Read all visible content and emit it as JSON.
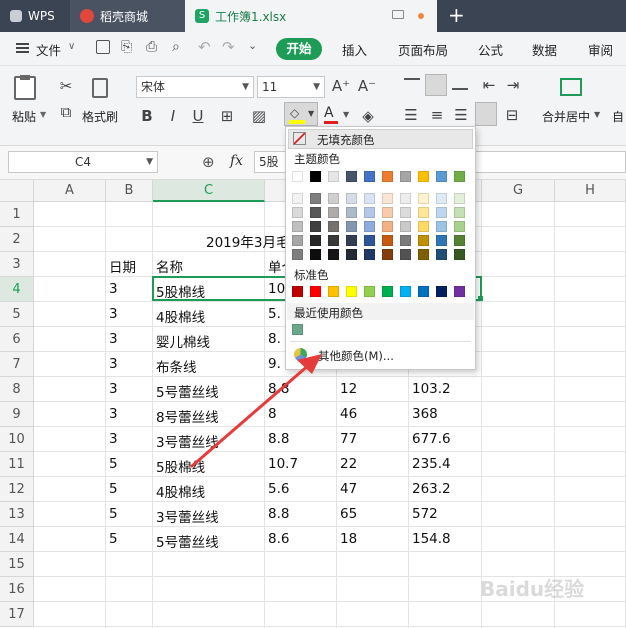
{
  "tabs": {
    "wps": "WPS",
    "shop": "稻壳商城",
    "workbook": "工作簿1.xlsx"
  },
  "menu": {
    "file": "文件",
    "start": "开始",
    "insert": "插入",
    "layout": "页面布局",
    "formula": "公式",
    "data": "数据",
    "review": "审阅"
  },
  "ribbon": {
    "paste": "粘贴",
    "format_painter": "格式刷",
    "font": "宋体",
    "size": "11",
    "merge": "合并居中",
    "auto": "自"
  },
  "formula": {
    "cellref": "C4",
    "fx": "fx",
    "content": "5股"
  },
  "columns": [
    "A",
    "B",
    "C",
    "D",
    "E",
    "F",
    "G",
    "H"
  ],
  "rows": [
    "1",
    "2",
    "3",
    "4",
    "5",
    "6",
    "7",
    "8",
    "9",
    "10",
    "11",
    "12",
    "13",
    "14",
    "15",
    "16",
    "17"
  ],
  "sheet": {
    "title": "2019年3月毛",
    "header": {
      "date": "日期",
      "name": "名称",
      "price": "单个"
    },
    "data": [
      {
        "r": 4,
        "b": "3",
        "c": "5股棉线",
        "d": "10.",
        "e": "",
        "f": ""
      },
      {
        "r": 5,
        "b": "3",
        "c": "4股棉线",
        "d": "5.",
        "e": "",
        "f": ""
      },
      {
        "r": 6,
        "b": "3",
        "c": "婴儿棉线",
        "d": "8.",
        "e": "",
        "f": ""
      },
      {
        "r": 7,
        "b": "3",
        "c": "布条线",
        "d": "9.",
        "e": "",
        "f": ""
      },
      {
        "r": 8,
        "b": "3",
        "c": "5号蕾丝线",
        "d": "8.8",
        "e": "12",
        "f": "103.2"
      },
      {
        "r": 9,
        "b": "3",
        "c": "8号蕾丝线",
        "d": "8",
        "e": "46",
        "f": "368"
      },
      {
        "r": 10,
        "b": "3",
        "c": "3号蕾丝线",
        "d": "8.8",
        "e": "77",
        "f": "677.6"
      },
      {
        "r": 11,
        "b": "5",
        "c": "5股棉线",
        "d": "10.7",
        "e": "22",
        "f": "235.4"
      },
      {
        "r": 12,
        "b": "5",
        "c": "4股棉线",
        "d": "5.6",
        "e": "47",
        "f": "263.2"
      },
      {
        "r": 13,
        "b": "5",
        "c": "3号蕾丝线",
        "d": "8.8",
        "e": "65",
        "f": "572"
      },
      {
        "r": 14,
        "b": "5",
        "c": "5号蕾丝线",
        "d": "8.6",
        "e": "18",
        "f": "154.8"
      }
    ]
  },
  "fill_menu": {
    "no_fill": "无填充颜色",
    "theme": "主题颜色",
    "standard": "标准色",
    "recent": "最近使用颜色",
    "more": "其他颜色(M)...",
    "theme_top": [
      "#ffffff",
      "#000000",
      "#e7e6e6",
      "#44546a",
      "#4472c4",
      "#ed7d31",
      "#a5a5a5",
      "#ffc000",
      "#5b9bd5",
      "#70ad47"
    ],
    "theme_shades": [
      [
        "#f2f2f2",
        "#7f7f7f",
        "#d0cece",
        "#d6dce5",
        "#dae3f3",
        "#fbe5d6",
        "#ededed",
        "#fff2cc",
        "#deebf7",
        "#e2f0d9"
      ],
      [
        "#d9d9d9",
        "#595959",
        "#aeabab",
        "#adb9ca",
        "#b4c7e7",
        "#f8cbad",
        "#dbdbdb",
        "#ffe699",
        "#bdd7ee",
        "#c5e0b4"
      ],
      [
        "#bfbfbf",
        "#404040",
        "#767171",
        "#8497b0",
        "#8faadc",
        "#f4b183",
        "#c9c9c9",
        "#ffd966",
        "#9dc3e6",
        "#a9d18e"
      ],
      [
        "#a6a6a6",
        "#262626",
        "#3b3838",
        "#333f50",
        "#2f5597",
        "#c55a11",
        "#7b7b7b",
        "#bf9000",
        "#2e75b6",
        "#548235"
      ],
      [
        "#7f7f7f",
        "#0d0d0d",
        "#171515",
        "#222a35",
        "#203864",
        "#843c0c",
        "#525252",
        "#7f6000",
        "#1f4e79",
        "#385723"
      ]
    ],
    "standard_colors": [
      "#c00000",
      "#ff0000",
      "#ffc000",
      "#ffff00",
      "#92d050",
      "#00b050",
      "#00b0f0",
      "#0070c0",
      "#002060",
      "#7030a0"
    ],
    "recent_colors": [
      "#6aa88a"
    ]
  },
  "watermark": "Baidu经验"
}
